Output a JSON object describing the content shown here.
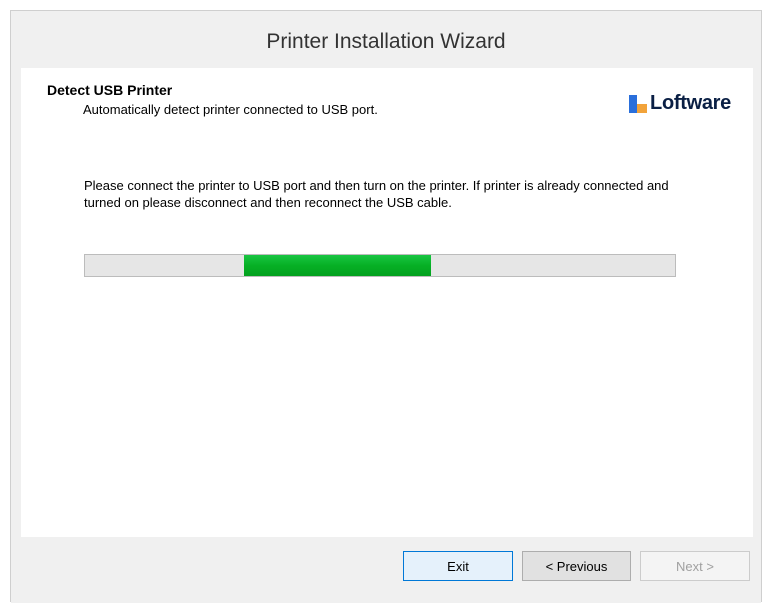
{
  "window": {
    "title": "Printer Installation Wizard"
  },
  "page": {
    "heading": "Detect USB Printer",
    "subheading": "Automatically detect printer connected to USB port.",
    "instructions": "Please connect the printer to USB port and then turn on the printer. If printer is already connected and turned on please disconnect and then reconnect the USB cable."
  },
  "logo": {
    "text": "Loftware"
  },
  "progress": {
    "style": "marquee",
    "segment_start_fraction": 0.27,
    "segment_end_fraction": 0.587,
    "fill_color": "#06b025"
  },
  "buttons": {
    "exit_label": "Exit",
    "previous_label": "< Previous",
    "next_label": "Next >"
  }
}
